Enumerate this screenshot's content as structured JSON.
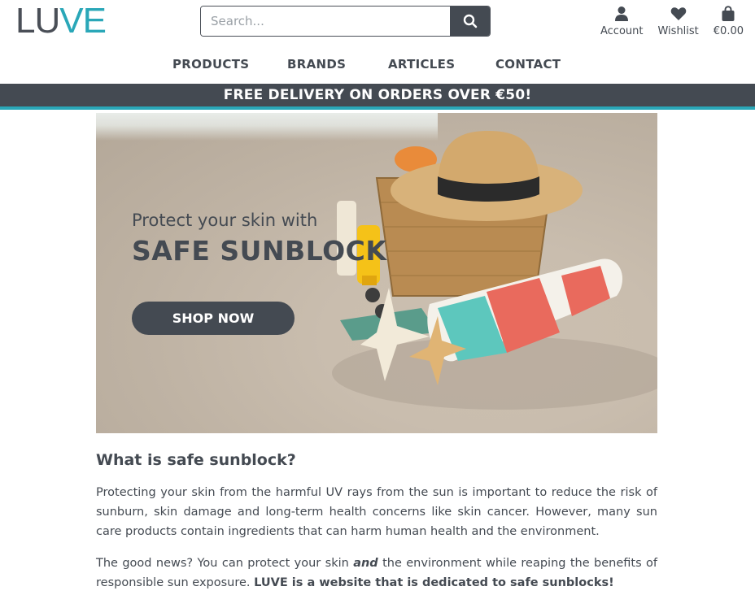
{
  "header": {
    "logo_part1": "LU",
    "logo_part2": "VE",
    "search_placeholder": "Search...",
    "search_value": "",
    "user_nav": {
      "account": "Account",
      "wishlist": "Wishlist",
      "cart_total": "€0.00"
    },
    "nav": [
      "PRODUCTS",
      "BRANDS",
      "ARTICLES",
      "CONTACT"
    ]
  },
  "banner": {
    "text": "FREE DELIVERY ON ORDERS OVER €50!"
  },
  "hero": {
    "tagline": "Protect your skin with",
    "headline": "SAFE SUNBLOCK",
    "cta": "SHOP NOW"
  },
  "article": {
    "heading": "What is safe sunblock?",
    "paragraph1": "Protecting your skin from the harmful UV rays from the sun is important to reduce the risk of sunburn, skin damage and long-term health concerns like skin cancer. However, many sun care products contain ingredients that can harm human health and the environment.",
    "p2_part1": "The good news? You can protect your skin ",
    "p2_em": "and",
    "p2_part2": " the environment while reaping the benefits of responsible sun exposure. ",
    "p2_strong": "LUVE is a website that is dedicated to safe sunblocks!"
  },
  "colors": {
    "primary_dark": "#444a52",
    "accent_teal": "#2aa7b8",
    "white": "#ffffff"
  },
  "icons": {
    "search": "search-icon",
    "account": "user-icon",
    "wishlist": "heart-icon",
    "cart": "shopping-bag-icon"
  }
}
